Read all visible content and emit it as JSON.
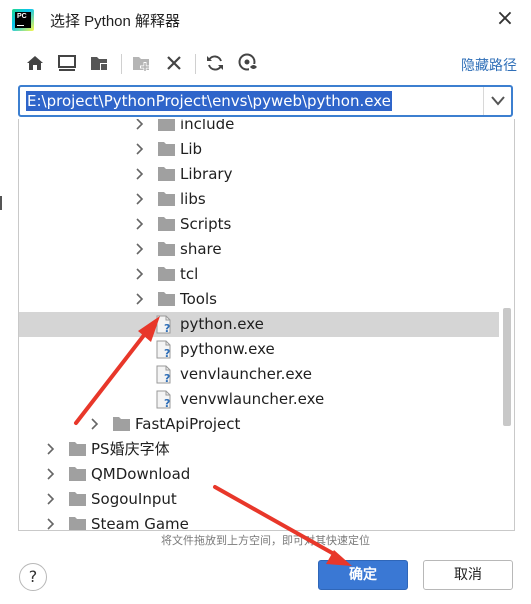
{
  "window": {
    "title": "选择 Python 解释器",
    "logo_text": "PC",
    "close_glyph": "×"
  },
  "toolbar": {
    "icons": [
      "home-icon",
      "desktop-icon",
      "project-folder-icon",
      "new-folder-icon",
      "delete-icon",
      "refresh-icon",
      "show-hidden-icon"
    ],
    "hidden_path_link": "隐藏路径"
  },
  "path": {
    "value": "E:\\project\\PythonProject\\envs\\pyweb\\python.exe"
  },
  "tree": {
    "rows": [
      {
        "label": "include",
        "type": "folder",
        "expandable": true
      },
      {
        "label": "Lib",
        "type": "folder",
        "expandable": true
      },
      {
        "label": "Library",
        "type": "folder",
        "expandable": true
      },
      {
        "label": "libs",
        "type": "folder",
        "expandable": true
      },
      {
        "label": "Scripts",
        "type": "folder",
        "expandable": true
      },
      {
        "label": "share",
        "type": "folder",
        "expandable": true
      },
      {
        "label": "tcl",
        "type": "folder",
        "expandable": true
      },
      {
        "label": "Tools",
        "type": "folder",
        "expandable": true
      },
      {
        "label": "python.exe",
        "type": "exe",
        "selected": true
      },
      {
        "label": "pythonw.exe",
        "type": "exe"
      },
      {
        "label": "venvlauncher.exe",
        "type": "exe"
      },
      {
        "label": "venvwlauncher.exe",
        "type": "exe"
      },
      {
        "label": "FastApiProject",
        "type": "folder",
        "expandable": true
      },
      {
        "label": "PS婚庆字体",
        "type": "folder",
        "expandable": true
      },
      {
        "label": "QMDownload",
        "type": "folder",
        "expandable": true
      },
      {
        "label": "SogouInput",
        "type": "folder",
        "expandable": true
      },
      {
        "label": "Steam Game",
        "type": "folder",
        "expandable": true
      }
    ]
  },
  "hint": "将文件拖放到上方空间，即可对其快速定位",
  "buttons": {
    "help": "?",
    "ok": "确定",
    "cancel": "取消"
  },
  "colors": {
    "accent": "#3a78d4",
    "selection": "#2f65ca",
    "link": "#2f6fb8",
    "annotation_arrow": "#e8372a"
  }
}
